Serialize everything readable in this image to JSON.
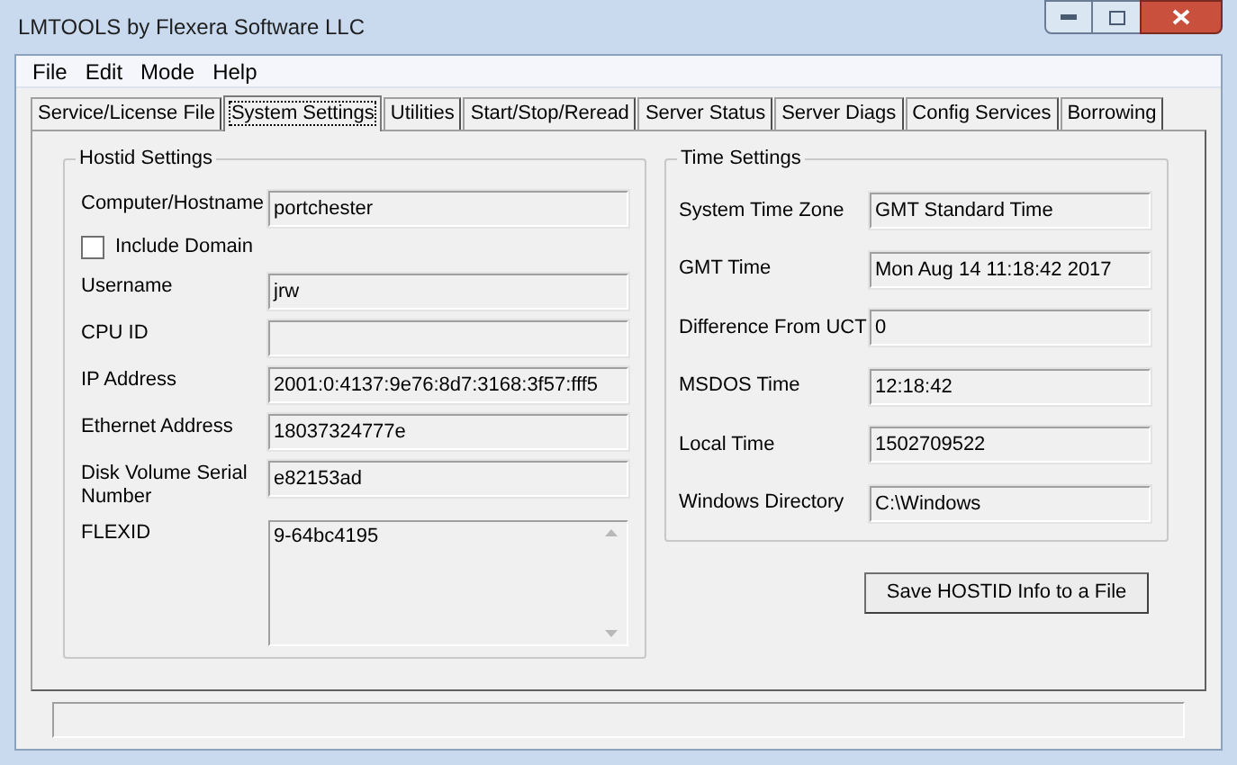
{
  "window": {
    "title": "LMTOOLS by Flexera Software LLC"
  },
  "menu": [
    "File",
    "Edit",
    "Mode",
    "Help"
  ],
  "tabs": [
    {
      "label": "Service/License File",
      "selected": false
    },
    {
      "label": "System Settings",
      "selected": true
    },
    {
      "label": "Utilities",
      "selected": false
    },
    {
      "label": "Start/Stop/Reread",
      "selected": false
    },
    {
      "label": "Server Status",
      "selected": false
    },
    {
      "label": "Server Diags",
      "selected": false
    },
    {
      "label": "Config Services",
      "selected": false
    },
    {
      "label": "Borrowing",
      "selected": false
    }
  ],
  "hostid_settings": {
    "title": "Hostid Settings",
    "fields": [
      {
        "kind": "text",
        "label": "Computer/Hostname",
        "value": "portchester"
      },
      {
        "kind": "checkbox",
        "label": "Include Domain",
        "checked": false
      },
      {
        "kind": "text",
        "label": "Username",
        "value": "jrw"
      },
      {
        "kind": "text",
        "label": "CPU ID"
      },
      {
        "kind": "text",
        "label": "IP Address",
        "value": "2001:0:4137:9e76:8d7:3168:3f57:fff5"
      },
      {
        "kind": "text",
        "label": "Ethernet Address",
        "value": "18037324777e"
      },
      {
        "kind": "text",
        "label": "Disk Volume Serial Number",
        "value": "e82153ad"
      },
      {
        "kind": "multiline",
        "label": "FLEXID",
        "value": "9-64bc4195"
      }
    ]
  },
  "time_settings": {
    "title": "Time Settings",
    "fields": [
      {
        "label": "System Time Zone",
        "value": "GMT Standard Time"
      },
      {
        "label": "GMT Time",
        "value": "Mon Aug 14 11:18:42 2017"
      },
      {
        "label": "Difference From UCT",
        "value": "0"
      },
      {
        "label": "MSDOS Time",
        "value": "12:18:42"
      },
      {
        "label": "Local Time",
        "value": "1502709522"
      },
      {
        "label": "Windows Directory",
        "value": "C:\\Windows"
      }
    ]
  },
  "save_button": "Save HOSTID Info to a File"
}
